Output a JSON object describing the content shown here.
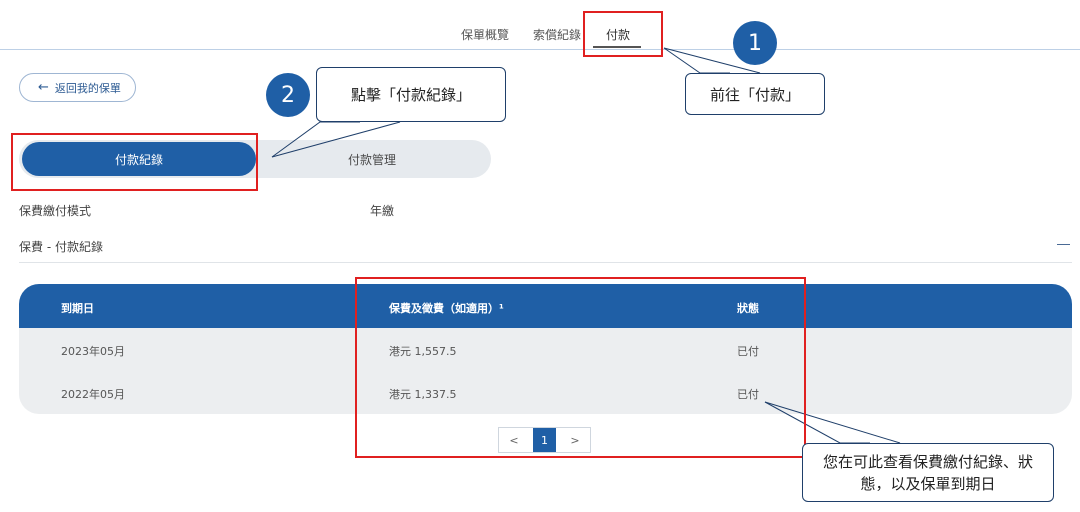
{
  "top_tabs": {
    "overview": "保單概覽",
    "claims": "索償紀錄",
    "payment": "付款"
  },
  "back_button": {
    "label": "返回我的保單"
  },
  "segments": {
    "records": "付款紀錄",
    "management": "付款管理"
  },
  "payment_mode": {
    "label": "保費繳付模式",
    "value": "年繳"
  },
  "section": {
    "title": "保費 - 付款紀錄"
  },
  "table": {
    "headers": {
      "due_date": "到期日",
      "amount": "保費及徵費（如適用）¹",
      "status": "狀態"
    },
    "rows": [
      {
        "due_date": "2023年05月",
        "amount": "港元 1,557.5",
        "status": "已付"
      },
      {
        "due_date": "2022年05月",
        "amount": "港元 1,337.5",
        "status": "已付"
      }
    ]
  },
  "pagination": {
    "prev": "<",
    "current": "1",
    "next": ">"
  },
  "annotations": {
    "step1_number": "1",
    "step1_text": "前往「付款」",
    "step2_number": "2",
    "step2_text": "點擊「付款紀錄」",
    "note_text": "您在可此查看保費繳付紀錄、狀態，以及保單到期日"
  },
  "colors": {
    "primary": "#1f5fa6",
    "highlight": "#e02020"
  }
}
